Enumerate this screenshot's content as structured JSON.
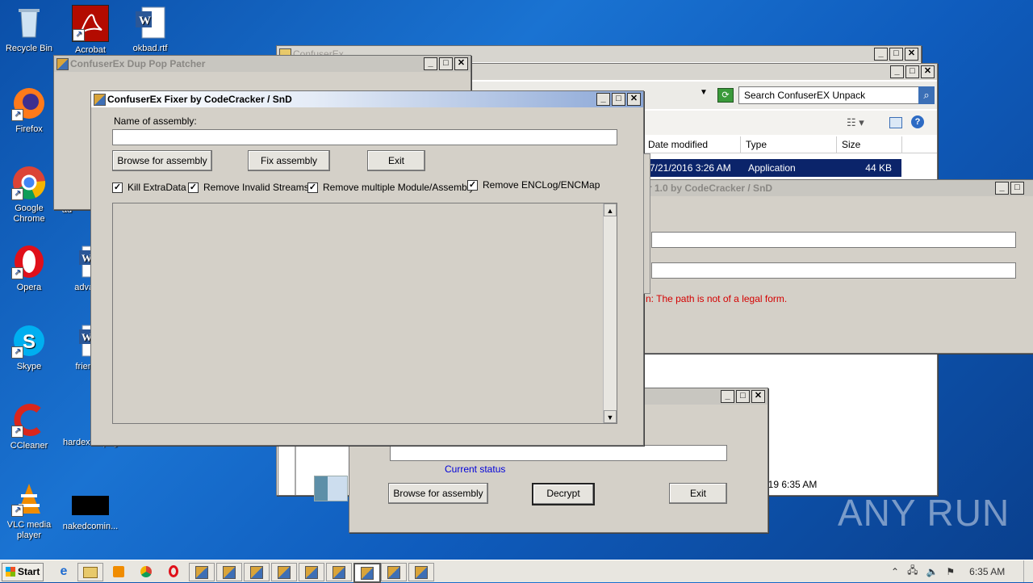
{
  "desktop": {
    "icons": [
      {
        "label": "Recycle Bin"
      },
      {
        "label": "Acrobat"
      },
      {
        "label": "okbad.rtf"
      },
      {
        "label": "Firefox"
      },
      {
        "label": "Google Chrome"
      },
      {
        "label": "ad"
      },
      {
        "label": "Opera"
      },
      {
        "label": "advanc"
      },
      {
        "label": "Skype"
      },
      {
        "label": "friends"
      },
      {
        "label": "CCleaner"
      },
      {
        "label": "hardextra.png"
      },
      {
        "label": "VLC media player"
      },
      {
        "label": "nakedcomin..."
      }
    ],
    "watermark": "ANY RUN"
  },
  "explorer": {
    "title": "ConfuserEx",
    "search_placeholder": "Search ConfuserEX Unpack",
    "columns": [
      "Date modified",
      "Type",
      "Size"
    ],
    "row": {
      "date": "7/21/2016 3:26 AM",
      "type": "Application",
      "size": "44 KB"
    },
    "row2_date": "019 6:35 AM"
  },
  "unpacker": {
    "title": "r 1.0 by CodeCracker / SnD",
    "error": "n: The path is not of a legal form."
  },
  "dup_pop": {
    "title": "ConfuserEx Dup Pop Patcher"
  },
  "decryptor": {
    "status": "Current status",
    "browse_label": "Browse for assembly",
    "decrypt_label": "Decrypt",
    "exit_label": "Exit"
  },
  "fixer": {
    "title": "ConfuserEx Fixer by CodeCracker / SnD",
    "name_label": "Name of assembly:",
    "name_value": "",
    "browse_label": "Browse for assembly",
    "fix_label": "Fix assembly",
    "exit_label": "Exit",
    "options": [
      {
        "label": "Kill ExtraData",
        "checked": true
      },
      {
        "label": "Remove Invalid Streams",
        "checked": true
      },
      {
        "label": "Remove multiple Module/Assembly",
        "checked": true
      },
      {
        "label": "Remove ENCLog/ENCMap",
        "checked": true
      }
    ]
  },
  "taskbar": {
    "start_label": "Start",
    "clock": "6:35 AM"
  }
}
